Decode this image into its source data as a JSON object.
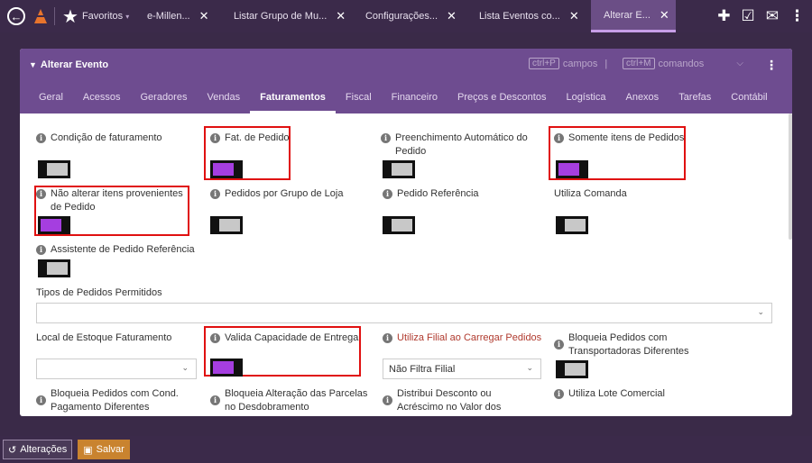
{
  "topbar": {
    "favorites_label": "Favoritos",
    "tabs": [
      {
        "label": "e-Millen..."
      },
      {
        "label": "Listar Grupo de Mu..."
      },
      {
        "label": "Configurações..."
      },
      {
        "label": "Lista Eventos co..."
      },
      {
        "label": "Alterar E..."
      }
    ]
  },
  "window": {
    "title": "Alterar Evento",
    "shortcut1_key": "ctrl+P",
    "shortcut1_label": "campos",
    "shortcut_sep": "|",
    "shortcut2_key": "ctrl+M",
    "shortcut2_label": "comandos"
  },
  "nav": {
    "tabs": [
      "Geral",
      "Acessos",
      "Geradores",
      "Vendas",
      "Faturamentos",
      "Fiscal",
      "Financeiro",
      "Preços e Descontos",
      "Logística",
      "Anexos",
      "Tarefas",
      "Contábil"
    ],
    "active": "Faturamentos"
  },
  "fields": {
    "condicao": "Condição de faturamento",
    "fat_pedido": "Fat. de Pedido",
    "preenchimento": "Preenchimento Automático do Pedido",
    "somente_itens": "Somente itens de Pedidos",
    "nao_alterar": "Não alterar itens provenientes de Pedido",
    "pedidos_grupo": "Pedidos por Grupo de Loja",
    "pedido_ref": "Pedido Referência",
    "utiliza_comanda": "Utiliza Comanda",
    "assistente": "Assistente de Pedido Referência",
    "tipos_pedidos": "Tipos de Pedidos Permitidos",
    "local_estoque": "Local de Estoque Faturamento",
    "valida_capacidade": "Valida Capacidade de Entrega",
    "utiliza_filial": "Utiliza Filial ao Carregar Pedidos",
    "utiliza_filial_value": "Não Filtra Filial",
    "bloqueia_transp": "Bloqueia Pedidos com Transportadoras Diferentes",
    "bloqueia_cond": "Bloqueia Pedidos com Cond. Pagamento Diferentes",
    "bloqueia_parcelas": "Bloqueia Alteração das Parcelas no Desdobramento",
    "distribui_desconto": "Distribui Desconto ou Acréscimo no Valor dos",
    "utiliza_lote": "Utiliza Lote Comercial"
  },
  "toggles": {
    "condicao": "off",
    "fat_pedido": "on",
    "preenchimento": "off",
    "somente_itens": "on",
    "nao_alterar": "on",
    "pedidos_grupo": "off",
    "pedido_ref": "off",
    "utiliza_comanda": "off",
    "assistente": "off",
    "valida_capacidade": "on",
    "bloqueia_transp": "off"
  },
  "bottom": {
    "alteracoes": "Alterações",
    "salvar": "Salvar"
  },
  "colors": {
    "accent": "#6e4c90",
    "toggle_on": "#a53ee0",
    "highlight": "#e01010",
    "save": "#c9832f"
  }
}
